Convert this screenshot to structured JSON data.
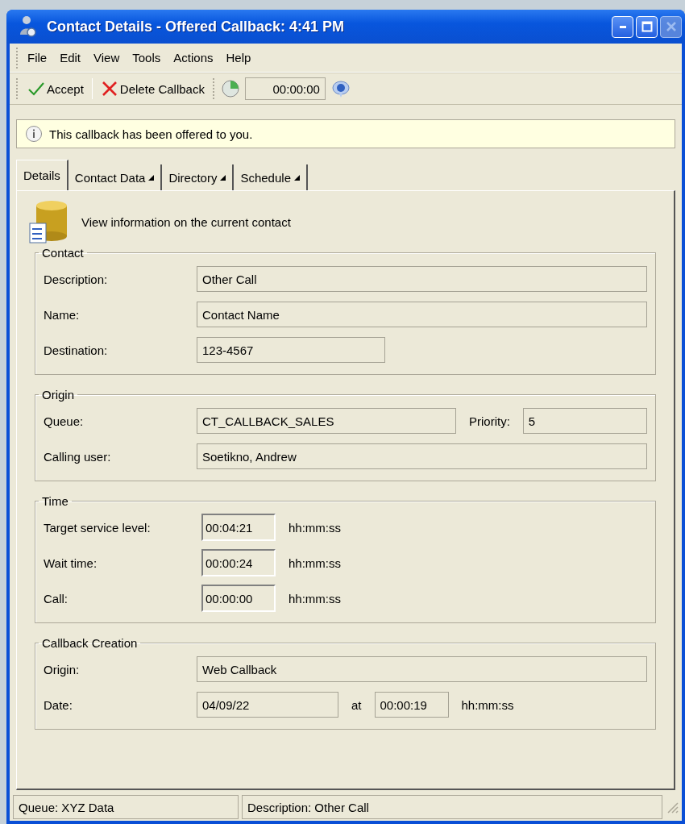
{
  "window": {
    "title": "Contact Details - Offered Callback: 4:41 PM",
    "controls": [
      {
        "kind": "minimize",
        "disabled": false
      },
      {
        "kind": "maximize",
        "disabled": false
      },
      {
        "kind": "close",
        "disabled": true
      }
    ]
  },
  "menu": [
    "File",
    "Edit",
    "View",
    "Tools",
    "Actions",
    "Help"
  ],
  "toolbar": {
    "buttons": [
      {
        "kind": "accept",
        "label": "Accept"
      },
      {
        "kind": "delete",
        "label": "Delete Callback"
      }
    ],
    "timer": "00:00:00"
  },
  "notice": "This callback  has been offered to you.",
  "tabs": [
    {
      "label": "Details",
      "selected": true,
      "has_menu": false
    },
    {
      "label": "Contact Data",
      "selected": false,
      "has_menu": true
    },
    {
      "label": "Directory",
      "selected": false,
      "has_menu": true
    },
    {
      "label": "Schedule",
      "selected": false,
      "has_menu": true
    }
  ],
  "header": "View information on the current contact",
  "groups": [
    {
      "title": "Contact",
      "rows": [
        {
          "label": "Description:",
          "items": [
            {
              "kind": "wide",
              "value": "Other Call"
            }
          ]
        },
        {
          "label": "Name:",
          "items": [
            {
              "kind": "wide",
              "value": "Contact Name"
            }
          ]
        },
        {
          "label": "Destination:",
          "items": [
            {
              "kind": "medium",
              "value": "123-4567"
            }
          ]
        }
      ]
    },
    {
      "title": "Origin",
      "rows": [
        {
          "label": "Queue:",
          "items": [
            {
              "kind": "large",
              "value": "CT_CALLBACK_SALES"
            },
            {
              "kind": "text",
              "text": "Priority:"
            },
            {
              "kind": "fill",
              "value": "5"
            }
          ]
        },
        {
          "label": "Calling user:",
          "items": [
            {
              "kind": "wide",
              "value": "Soetikno, Andrew"
            }
          ]
        }
      ]
    },
    {
      "title": "Time",
      "rows": [
        {
          "label": "Target service level:",
          "items": [
            {
              "kind": "time",
              "value": "00:04:21"
            },
            {
              "kind": "text",
              "text": "hh:mm:ss"
            }
          ]
        },
        {
          "label": "Wait time:",
          "items": [
            {
              "kind": "time",
              "value": "00:00:24"
            },
            {
              "kind": "text",
              "text": "hh:mm:ss"
            }
          ]
        },
        {
          "label": "Call:",
          "items": [
            {
              "kind": "time",
              "value": "00:00:00"
            },
            {
              "kind": "text",
              "text": "hh:mm:ss"
            }
          ]
        }
      ]
    },
    {
      "title": "Callback Creation",
      "rows": [
        {
          "label": "Origin:",
          "items": [
            {
              "kind": "wide",
              "value": "Web Callback"
            }
          ]
        },
        {
          "label": "Date:",
          "items": [
            {
              "kind": "small",
              "value": "04/09/22"
            },
            {
              "kind": "text",
              "text": "at"
            },
            {
              "kind": "tiny",
              "value": "00:00:19"
            },
            {
              "kind": "text",
              "text": "hh:mm:ss"
            }
          ]
        }
      ]
    }
  ],
  "status_bar": [
    "Queue:  XYZ Data",
    "Description:  Other Call"
  ]
}
